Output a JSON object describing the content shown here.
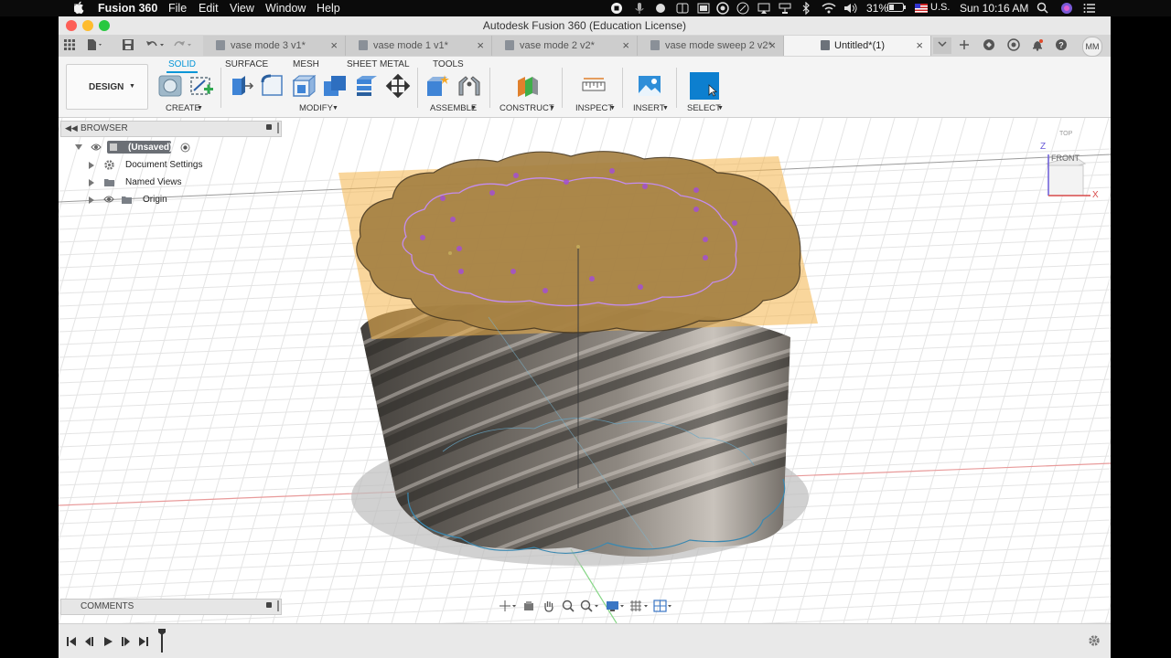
{
  "menubar": {
    "app_name": "Fusion 360",
    "menus": [
      "File",
      "Edit",
      "View",
      "Window",
      "Help"
    ],
    "battery": "31%",
    "input_source": "U.S.",
    "clock": "Sun 10:16 AM"
  },
  "window": {
    "title": "Autodesk Fusion 360 (Education License)"
  },
  "tabs": [
    {
      "label": "vase mode 3 v1*"
    },
    {
      "label": "vase mode 1 v1*"
    },
    {
      "label": "vase mode 2 v2*"
    },
    {
      "label": "vase mode sweep 2 v2*"
    },
    {
      "label": "Untitled*(1)"
    }
  ],
  "user_initials": "MM",
  "toolbar": {
    "workspace": "DESIGN",
    "tabs": [
      "SOLID",
      "SURFACE",
      "MESH",
      "SHEET METAL",
      "TOOLS"
    ],
    "groups": [
      "CREATE",
      "MODIFY",
      "ASSEMBLE",
      "CONSTRUCT",
      "INSPECT",
      "INSERT",
      "SELECT"
    ]
  },
  "browser": {
    "header": "BROWSER",
    "root": "(Unsaved)",
    "items": [
      "Document Settings",
      "Named Views",
      "Origin"
    ]
  },
  "comments": {
    "header": "COMMENTS"
  },
  "viewcube": {
    "face_front": "FRONT",
    "face_top": "TOP",
    "axis_x": "X",
    "axis_z": "Z"
  },
  "colors": {
    "accent": "#0696d7",
    "sketch_plane": "#f4b54a",
    "model": "#5b5752",
    "profile": "#a24fd1"
  }
}
